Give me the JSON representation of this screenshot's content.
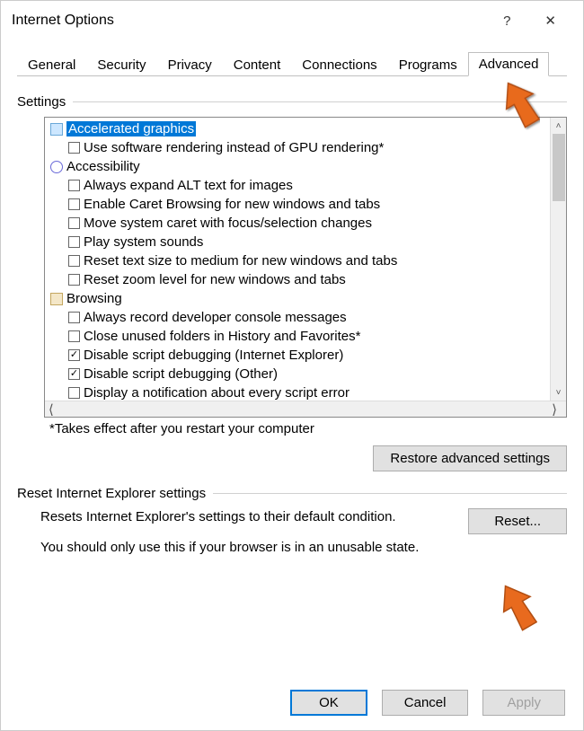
{
  "title": "Internet Options",
  "tabs": [
    "General",
    "Security",
    "Privacy",
    "Content",
    "Connections",
    "Programs",
    "Advanced"
  ],
  "active_tab_index": 6,
  "settings_label": "Settings",
  "tree": {
    "categories": [
      {
        "icon": "gfx",
        "label": "Accelerated graphics",
        "selected": true,
        "items": [
          {
            "checked": false,
            "label": "Use software rendering instead of GPU rendering*"
          }
        ]
      },
      {
        "icon": "acc",
        "label": "Accessibility",
        "items": [
          {
            "checked": false,
            "label": "Always expand ALT text for images"
          },
          {
            "checked": false,
            "label": "Enable Caret Browsing for new windows and tabs"
          },
          {
            "checked": false,
            "label": "Move system caret with focus/selection changes"
          },
          {
            "checked": false,
            "label": "Play system sounds"
          },
          {
            "checked": false,
            "label": "Reset text size to medium for new windows and tabs"
          },
          {
            "checked": false,
            "label": "Reset zoom level for new windows and tabs"
          }
        ]
      },
      {
        "icon": "brw",
        "label": "Browsing",
        "items": [
          {
            "checked": false,
            "label": "Always record developer console messages"
          },
          {
            "checked": false,
            "label": "Close unused folders in History and Favorites*"
          },
          {
            "checked": true,
            "label": "Disable script debugging (Internet Explorer)"
          },
          {
            "checked": true,
            "label": "Disable script debugging (Other)"
          },
          {
            "checked": false,
            "label": "Display a notification about every script error"
          }
        ]
      }
    ]
  },
  "footnote": "*Takes effect after you restart your computer",
  "restore_button": "Restore advanced settings",
  "reset_group_label": "Reset Internet Explorer settings",
  "reset_description": "Resets Internet Explorer's settings to their default condition.",
  "reset_button": "Reset...",
  "unusable_text": "You should only use this if your browser is in an unusable state.",
  "buttons": {
    "ok": "OK",
    "cancel": "Cancel",
    "apply": "Apply"
  }
}
